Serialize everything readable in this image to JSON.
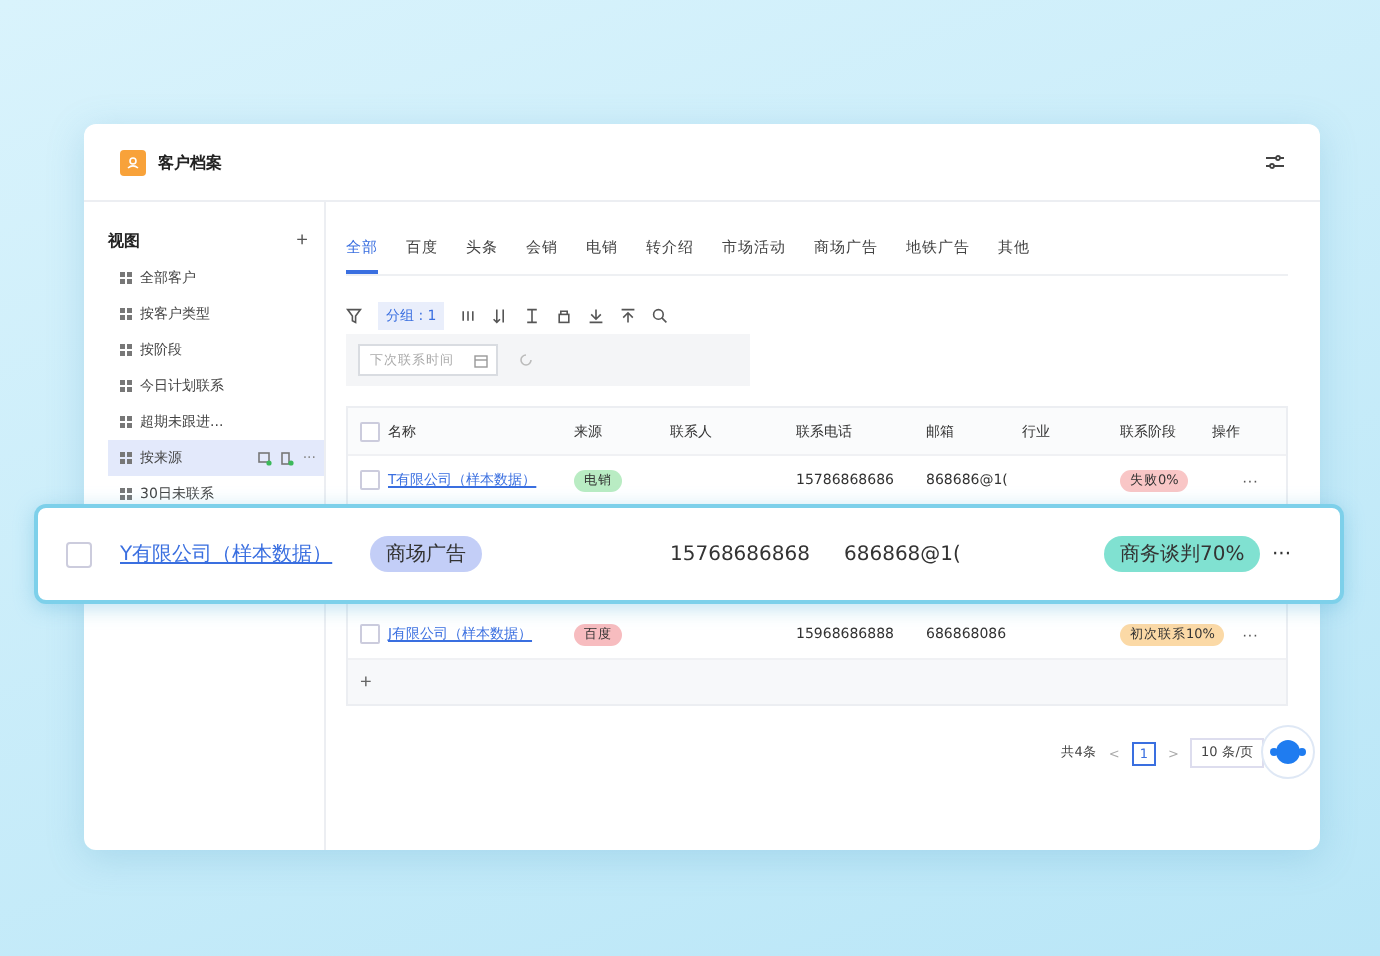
{
  "app": {
    "title": "客户档案"
  },
  "sidebar": {
    "heading": "视图",
    "add": "+",
    "items": [
      {
        "label": "全部客户",
        "selected": false
      },
      {
        "label": "按客户类型",
        "selected": false
      },
      {
        "label": "按阶段",
        "selected": false
      },
      {
        "label": "今日计划联系",
        "selected": false
      },
      {
        "label": "超期未跟进...",
        "selected": false
      },
      {
        "label": "按来源",
        "selected": true,
        "more": "···"
      },
      {
        "label": "30日未联系",
        "selected": false
      }
    ]
  },
  "tabs": [
    {
      "label": "全部",
      "selected": true
    },
    {
      "label": "百度",
      "selected": false
    },
    {
      "label": "头条",
      "selected": false
    },
    {
      "label": "会销",
      "selected": false
    },
    {
      "label": "电销",
      "selected": false
    },
    {
      "label": "转介绍",
      "selected": false
    },
    {
      "label": "市场活动",
      "selected": false
    },
    {
      "label": "商场广告",
      "selected": false
    },
    {
      "label": "地铁广告",
      "selected": false
    },
    {
      "label": "其他",
      "selected": false
    }
  ],
  "toolbar": {
    "group": "分组 : 1"
  },
  "filter": {
    "placeholder": "下次联系时间"
  },
  "table": {
    "select_all": false,
    "columns": [
      "名称",
      "来源",
      "联系人",
      "联系电话",
      "邮箱",
      "行业",
      "联系阶段",
      "操作"
    ],
    "rows": [
      {
        "checked": false,
        "name": "T有限公司（样本数据）",
        "source": {
          "label": "电销",
          "color": "#b9ecc3"
        },
        "phone": "15786868686",
        "email": "868686@1(",
        "stage": {
          "label": "失败0%",
          "color": "#f9c6c6"
        },
        "action": "···"
      },
      {
        "checked": false,
        "name": "J有限公司（样本数据）",
        "source": {
          "label": "百度",
          "color": "#f7bcbf"
        },
        "phone": "15968686888",
        "email": "686868086",
        "stage": {
          "label": "初次联系10%",
          "color": "#fbd9a6"
        },
        "action": "···"
      }
    ],
    "add": "+"
  },
  "highlighted_row": {
    "checked": false,
    "name": "Y有限公司（样本数据）",
    "source": {
      "label": "商场广告",
      "color": "#c3cef7"
    },
    "phone": "15768686868",
    "email": "686868@1(",
    "stage": {
      "label": "商务谈判70%",
      "color": "#80e1d1"
    },
    "action": "···"
  },
  "pagination": {
    "total": "共4条",
    "prev": "<",
    "page": "1",
    "next": ">",
    "size": "10 条/页"
  }
}
